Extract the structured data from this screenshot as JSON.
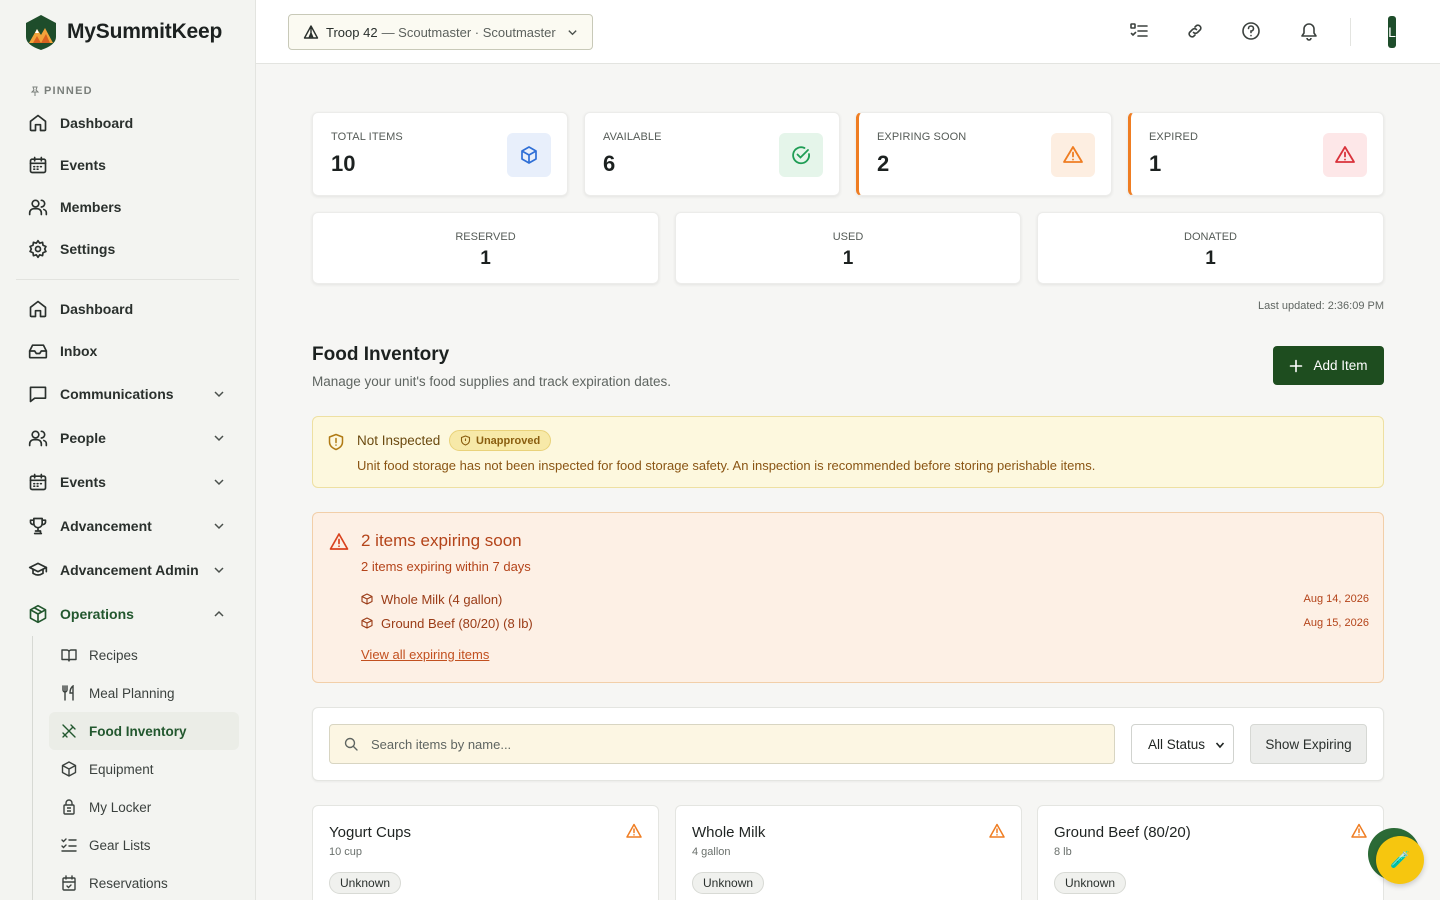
{
  "brand": {
    "name": "MySummitKeep"
  },
  "sidebar": {
    "pinned_label": "PINNED",
    "pinned": [
      {
        "label": "Dashboard",
        "icon": "home-icon"
      },
      {
        "label": "Events",
        "icon": "calendar-icon"
      },
      {
        "label": "Members",
        "icon": "users-icon"
      },
      {
        "label": "Settings",
        "icon": "gear-icon"
      }
    ],
    "main": [
      {
        "label": "Dashboard",
        "icon": "home-icon"
      },
      {
        "label": "Inbox",
        "icon": "inbox-icon"
      },
      {
        "label": "Communications",
        "icon": "message-icon"
      },
      {
        "label": "People",
        "icon": "users-icon"
      },
      {
        "label": "Events",
        "icon": "calendar-icon"
      },
      {
        "label": "Advancement",
        "icon": "trophy-icon"
      },
      {
        "label": "Advancement Admin",
        "icon": "graduation-cap-icon"
      },
      {
        "label": "Operations",
        "icon": "package-icon"
      }
    ],
    "operations_sub": [
      {
        "label": "Recipes",
        "icon": "book-open-icon"
      },
      {
        "label": "Meal Planning",
        "icon": "utensils-icon"
      },
      {
        "label": "Food Inventory",
        "icon": "utensils-crossed-icon"
      },
      {
        "label": "Equipment",
        "icon": "package-icon"
      },
      {
        "label": "My Locker",
        "icon": "lock-icon"
      },
      {
        "label": "Gear Lists",
        "icon": "list-checks-icon"
      },
      {
        "label": "Reservations",
        "icon": "calendar-check-icon"
      }
    ]
  },
  "header": {
    "unit": "Troop 42",
    "unit_role": "— Scoutmaster · Scoutmaster",
    "avatar_letter": "L"
  },
  "stats": {
    "total_items": {
      "label": "Total Items",
      "value": "10"
    },
    "available": {
      "label": "Available",
      "value": "6"
    },
    "expiring_soon": {
      "label": "Expiring Soon",
      "value": "2"
    },
    "expired": {
      "label": "Expired",
      "value": "1"
    },
    "reserved": {
      "label": "Reserved",
      "value": "1"
    },
    "used": {
      "label": "Used",
      "value": "1"
    },
    "donated": {
      "label": "Donated",
      "value": "1"
    }
  },
  "last_updated": "Last updated: 2:36:09 PM",
  "page": {
    "title": "Food Inventory",
    "subtitle": "Manage your unit's food supplies and track expiration dates.",
    "add_button": "Add Item"
  },
  "inspection": {
    "title": "Not Inspected",
    "badge": "Unapproved",
    "text": "Unit food storage has not been inspected for food storage safety. An inspection is recommended before storing perishable items."
  },
  "expiring": {
    "title": "2 items expiring soon",
    "subtitle": "2 items expiring within 7 days",
    "items": [
      {
        "name": "Whole Milk (4 gallon)",
        "date": "Aug 14, 2026"
      },
      {
        "name": "Ground Beef (80/20) (8 lb)",
        "date": "Aug 15, 2026"
      }
    ],
    "link": "View all expiring items"
  },
  "filters": {
    "search_placeholder": "Search items by name...",
    "status": "All Status",
    "show_expiring": "Show Expiring"
  },
  "items": [
    {
      "name": "Yogurt Cups",
      "qty": "10 cup",
      "status": "Unknown"
    },
    {
      "name": "Whole Milk",
      "qty": "4 gallon",
      "status": "Unknown"
    },
    {
      "name": "Ground Beef (80/20)",
      "qty": "8 lb",
      "status": "Unknown"
    }
  ],
  "fab_icon": "🧪",
  "colors": {
    "brand_green": "#1e4d1f",
    "warning_orange": "#ef7d22",
    "danger_red": "#d9323b",
    "info_blue": "#2f6fd6",
    "success_green": "#1f9d55"
  }
}
